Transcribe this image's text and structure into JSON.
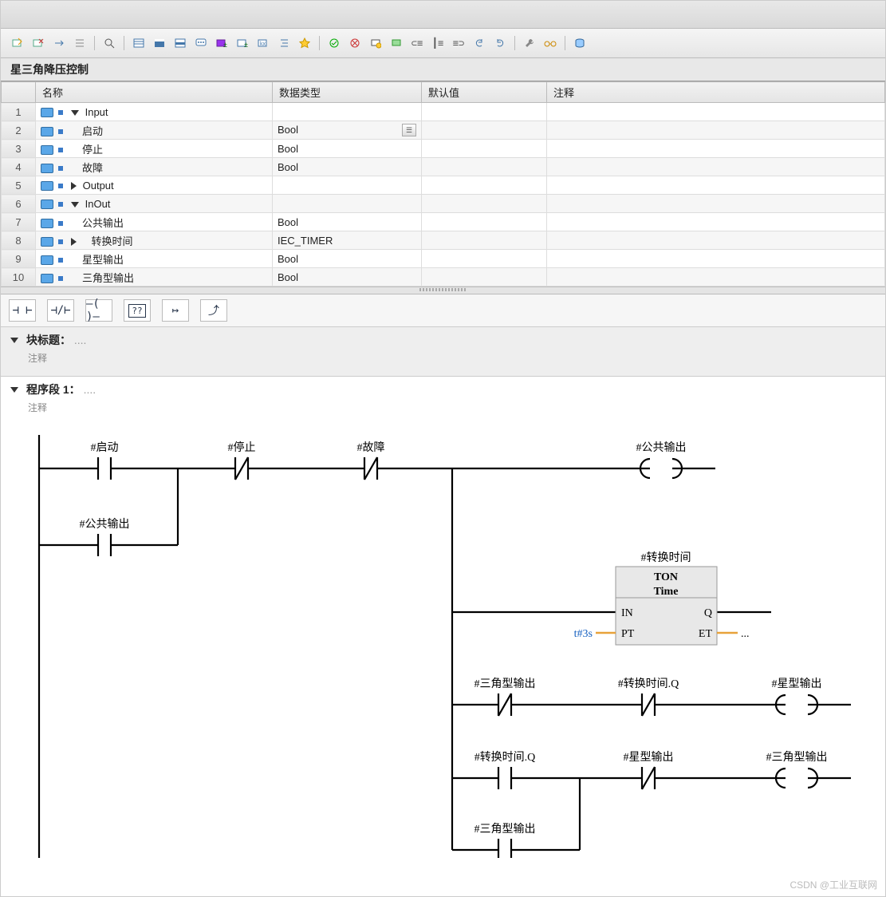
{
  "block_title": "星三角降压控制",
  "columns": {
    "name": "名称",
    "type": "数据类型",
    "default": "默认值",
    "comment": "注释"
  },
  "rows": [
    {
      "num": "1",
      "kind": "group-open",
      "name": "Input",
      "type": "",
      "def": ""
    },
    {
      "num": "2",
      "kind": "var",
      "name": "启动",
      "type": "Bool",
      "def": "",
      "dd": true
    },
    {
      "num": "3",
      "kind": "var",
      "name": "停止",
      "type": "Bool",
      "def": ""
    },
    {
      "num": "4",
      "kind": "var",
      "name": "故障",
      "type": "Bool",
      "def": ""
    },
    {
      "num": "5",
      "kind": "group-closed",
      "name": "Output",
      "type": "",
      "def": ""
    },
    {
      "num": "6",
      "kind": "group-open",
      "name": "InOut",
      "type": "",
      "def": ""
    },
    {
      "num": "7",
      "kind": "var",
      "name": "公共输出",
      "type": "Bool",
      "def": ""
    },
    {
      "num": "8",
      "kind": "var-closed",
      "name": "转换时间",
      "type": "IEC_TIMER",
      "def": ""
    },
    {
      "num": "9",
      "kind": "var",
      "name": "星型输出",
      "type": "Bool",
      "def": ""
    },
    {
      "num": "10",
      "kind": "var",
      "name": "三角型输出",
      "type": "Bool",
      "def": ""
    }
  ],
  "ladbtns": [
    "⊣ ⊢",
    "⊣/⊢",
    "–( )–",
    "??",
    "↦",
    "⤴"
  ],
  "sec_block": {
    "title": "块标题：",
    "sub": "....",
    "comment": "注释"
  },
  "sec_net": {
    "title": "程序段 1：",
    "sub": "....",
    "comment": "注释"
  },
  "lad": {
    "c1": "#启动",
    "c2": "#停止",
    "c3": "#故障",
    "coil1": "#公共输出",
    "c1b": "#公共输出",
    "timer_tag": "#转换时间",
    "timer_type": "TON",
    "timer_time": "Time",
    "timer_in": "IN",
    "timer_q": "Q",
    "timer_pt": "PT",
    "timer_et": "ET",
    "timer_ptval": "t#3s",
    "timer_etval": "...",
    "r3a": "#三角型输出",
    "r3b": "#转换时间.Q",
    "r3c": "#星型输出",
    "r4a": "#转换时间.Q",
    "r4b": "#星型输出",
    "r4c": "#三角型输出",
    "r5a": "#三角型输出"
  },
  "watermark": "CSDN @工业互联网"
}
